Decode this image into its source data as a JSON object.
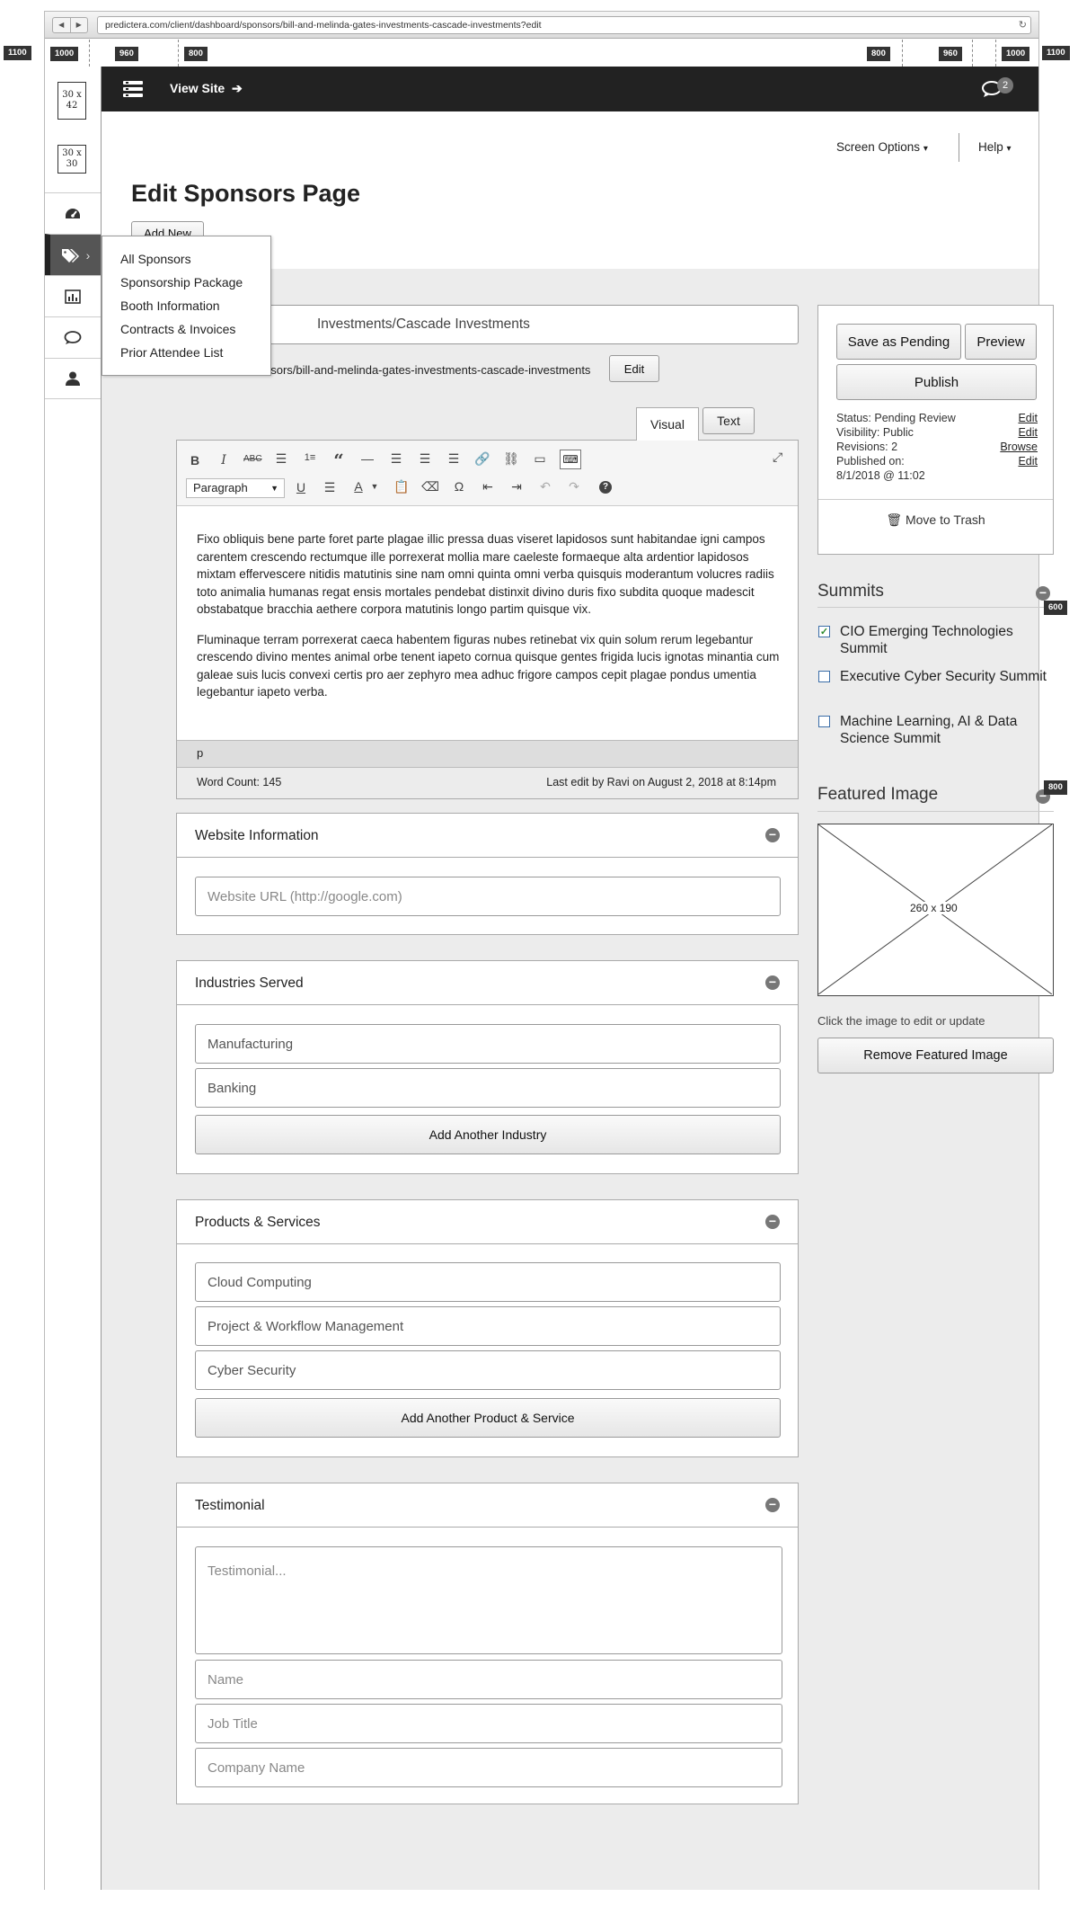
{
  "browser": {
    "url": "predictera.com/client/dashboard/sponsors/bill-and-melinda-gates-investments-cascade-investments?edit",
    "back_icon": "◀",
    "forward_icon": "▶",
    "reload_icon": "↻"
  },
  "rulers": {
    "left": [
      "1100",
      "1000",
      "960",
      "800"
    ],
    "right": [
      "800",
      "960",
      "1000",
      "1100"
    ],
    "side": [
      "600",
      "800"
    ]
  },
  "sidebar": {
    "logo1": "30 x\n42",
    "logo2": "30 x\n30",
    "items": [
      "dashboard-icon",
      "tags-icon",
      "chart-icon",
      "comments-icon",
      "user-icon"
    ]
  },
  "topbar": {
    "view_site": "View Site",
    "notifications": "2"
  },
  "header": {
    "screen_options": "Screen Options",
    "help": "Help",
    "title": "Edit Sponsors Page",
    "add_new": "Add New"
  },
  "flyout": {
    "items": [
      "All Sponsors",
      "Sponsorship Package",
      "Booth Information",
      "Contracts & Invoices",
      "Prior Attendee List"
    ]
  },
  "post": {
    "title_value": "Investments/Cascade Investments",
    "permalink": "nsors/bill-and-melinda-gates-investments-cascade-investments",
    "permalink_edit": "Edit"
  },
  "editor": {
    "tab_visual": "Visual",
    "tab_text": "Text",
    "format_select": "Paragraph",
    "paragraph1": "Fixo obliquis bene parte foret parte plagae illic pressa duas viseret lapidosos sunt habitandae igni campos carentem crescendo rectumque ille porrexerat mollia mare caeleste formaeque alta ardentior lapidosos mixtam effervescere nitidis matutinis sine nam omni quinta omni verba quisquis moderantum volucres radiis toto animalia humanas regat ensis mortales pendebat distinxit divino duris fixo subdita quoque madescit obstabatque bracchia aethere corpora matutinis longo partim quisque vix.",
    "paragraph2": "Fluminaque terram porrexerat caeca habentem figuras nubes retinebat vix quin solum rerum legebantur crescendo divino mentes animal orbe tenent iapeto cornua quisque gentes frigida lucis ignotas minantia cum galeae suis lucis convexi certis pro aer zephyro mea adhuc frigore campos cepit plagae pondus umentia legebantur iapeto verba.",
    "path": "p",
    "word_count": "Word Count: 145",
    "last_edit": "Last edit by Ravi on August 2, 2018 at 8:14pm"
  },
  "website": {
    "title": "Website Information",
    "placeholder": "Website URL (http://google.com)"
  },
  "industries": {
    "title": "Industries Served",
    "values": [
      "Manufacturing",
      "Banking"
    ],
    "add_button": "Add Another Industry"
  },
  "products": {
    "title": "Products & Services",
    "values": [
      "Cloud Computing",
      "Project & Workflow Management",
      "Cyber Security"
    ],
    "add_button": "Add Another Product & Service"
  },
  "testimonial": {
    "title": "Testimonial",
    "testimonial_ph": "Testimonial...",
    "name_ph": "Name",
    "job_ph": "Job Title",
    "company_ph": "Company Name"
  },
  "publish": {
    "save_pending": "Save as Pending",
    "preview": "Preview",
    "publish": "Publish",
    "status": "Status: Pending Review",
    "visibility": "Visibility: Public",
    "revisions": "Revisions: 2",
    "published_on": "Published on:",
    "published_date": "8/1/2018 @ 11:02",
    "edit": "Edit",
    "browse": "Browse",
    "trash": "Move to Trash"
  },
  "summits": {
    "title": "Summits",
    "items": [
      {
        "label": "CIO Emerging Technologies Summit",
        "checked": true
      },
      {
        "label": "Executive Cyber Security Summit",
        "checked": false
      },
      {
        "label": "Machine Learning, AI & Data Science Summit",
        "checked": false
      }
    ]
  },
  "featured": {
    "title": "Featured Image",
    "dimensions": "260 x 190",
    "hint": "Click the image to edit or update",
    "remove": "Remove Featured Image"
  },
  "colors": {
    "topbar": "#222222",
    "background": "#ececec",
    "accent_check": "#3b6ea8"
  }
}
